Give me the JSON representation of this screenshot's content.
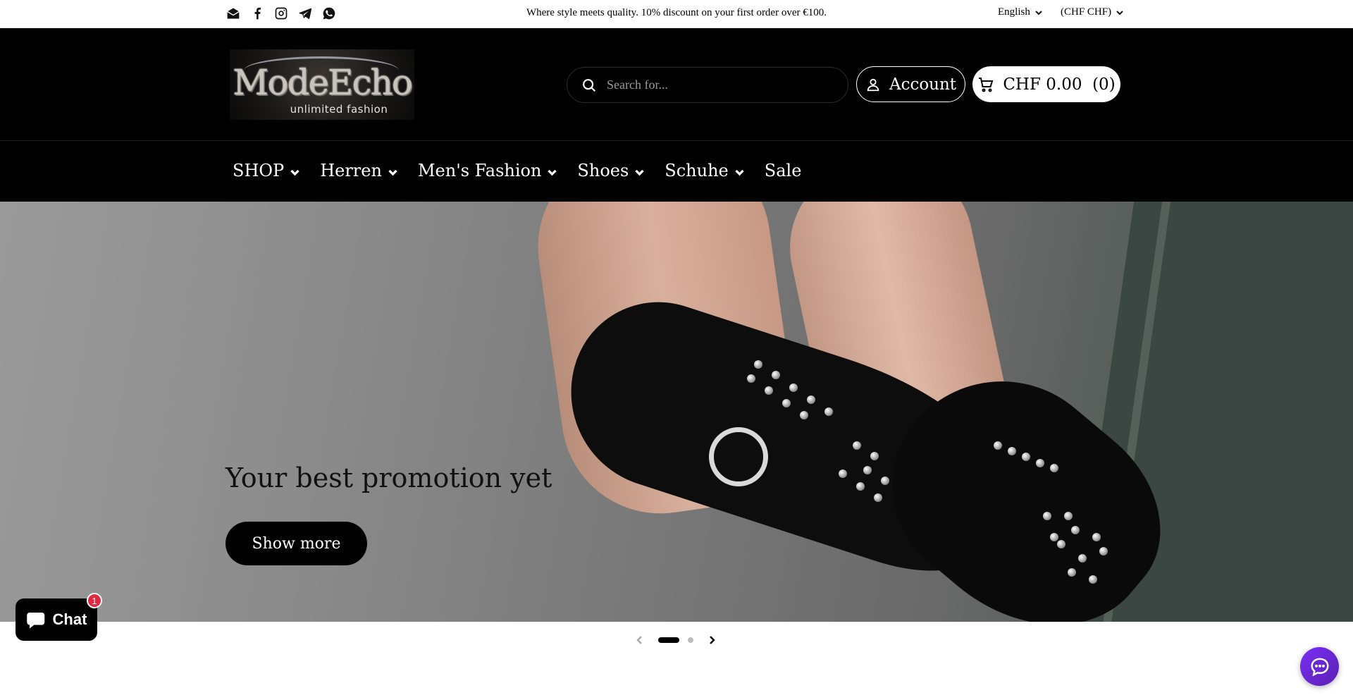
{
  "announcement": {
    "text": "Where style meets quality. 10% discount on your first order over €100.",
    "language": "English",
    "currency": "(CHF CHF)"
  },
  "social_icons": [
    "email-icon",
    "facebook-icon",
    "instagram-icon",
    "telegram-icon",
    "whatsapp-icon"
  ],
  "header": {
    "logo_text": "ModeEcho",
    "logo_tagline": "unlimited fashion",
    "search_placeholder": "Search for...",
    "account_label": "Account",
    "cart_label": "CHF 0.00  (0)"
  },
  "nav": {
    "items": [
      {
        "label": "SHOP",
        "has_dropdown": true
      },
      {
        "label": "Herren",
        "has_dropdown": true
      },
      {
        "label": "Men's Fashion",
        "has_dropdown": true
      },
      {
        "label": "Shoes",
        "has_dropdown": true
      },
      {
        "label": "Schuhe",
        "has_dropdown": true
      },
      {
        "label": "Sale",
        "has_dropdown": false
      }
    ]
  },
  "hero": {
    "title": "Your best promotion yet",
    "button_label": "Show more",
    "slide_count": 2,
    "active_slide": 1
  },
  "chat": {
    "label": "Chat",
    "badge": "1"
  },
  "colors": {
    "header_bg": "#000000",
    "accent_badge": "#e3283e",
    "messenger": "#7b2ff7"
  }
}
